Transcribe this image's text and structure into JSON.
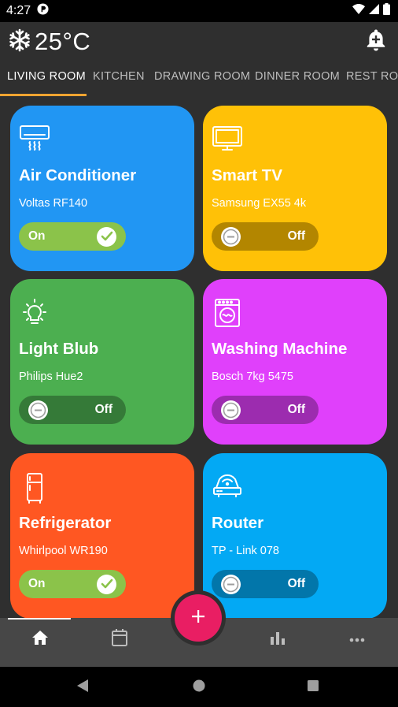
{
  "status": {
    "time": "4:27"
  },
  "header": {
    "temperature": "25°C"
  },
  "tabs": [
    {
      "label": "LIVING ROOM"
    },
    {
      "label": "KITCHEN"
    },
    {
      "label": "DRAWING ROOM"
    },
    {
      "label": "DINNER ROOM"
    },
    {
      "label": "REST ROOM"
    }
  ],
  "devices": [
    {
      "name": "Air Conditioner",
      "model": "Voltas RF140",
      "state": "On",
      "icon": "air-conditioner-icon",
      "color": "#2196f3",
      "toggle_color": "#8bc34a"
    },
    {
      "name": "Smart TV",
      "model": "Samsung EX55 4k",
      "state": "Off",
      "icon": "tv-icon",
      "color": "#ffc107",
      "toggle_color": "#b38600"
    },
    {
      "name": "Light Blub",
      "model": "Philips Hue2",
      "state": "Off",
      "icon": "light-bulb-icon",
      "color": "#4caf50",
      "toggle_color": "#357a38"
    },
    {
      "name": "Washing Machine",
      "model": "Bosch 7kg 5475",
      "state": "Off",
      "icon": "washing-machine-icon",
      "color": "#e040fb",
      "toggle_color": "#9c2caf"
    },
    {
      "name": "Refrigerator",
      "model": "Whirlpool WR190",
      "state": "On",
      "icon": "refrigerator-icon",
      "color": "#ff5722",
      "toggle_color": "#8bc34a"
    },
    {
      "name": "Router",
      "model": "TP - Link 078",
      "state": "Off",
      "icon": "router-icon",
      "color": "#03a9f4",
      "toggle_color": "#0276aa"
    }
  ],
  "bottom_nav": [
    "home-icon",
    "calendar-icon",
    "add-icon",
    "bar-chart-icon",
    "more-icon"
  ],
  "fab_color": "#e91e63"
}
